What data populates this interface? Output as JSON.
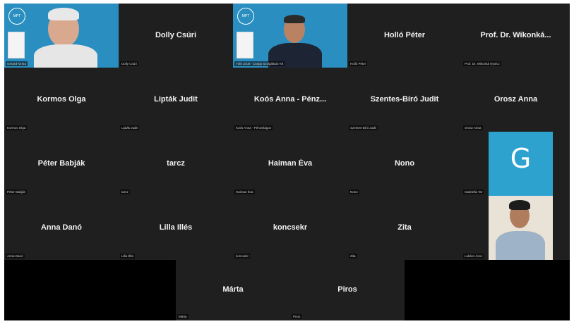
{
  "participants": {
    "p1": {
      "tag": "Gerard Kintra"
    },
    "p2": {
      "name": "Dolly Csúri",
      "tag": "Dolly Csúri"
    },
    "p3": {
      "tag": "Tóth Zsolt - Csepp Szolgáltató Kft"
    },
    "p4": {
      "name": "Holló Péter",
      "tag": "Holló Péter"
    },
    "p5": {
      "name": "Prof. Dr. Wikonká...",
      "tag": "Prof. Dr. Wikonká Nyolcz"
    },
    "p6": {
      "name": "Kormos Olga",
      "tag": "Kormos Olga"
    },
    "p7": {
      "name": "Lipták Judit",
      "tag": "Lipták Judit"
    },
    "p8": {
      "name": "Koós Anna - Pénz...",
      "tag": "Koós Anna - Pénzvilágon"
    },
    "p9": {
      "name": "Szentes-Bíró Judit",
      "tag": "Szentes-Bíró Judit"
    },
    "p10": {
      "name": "Orosz Anna",
      "tag": "Orosz Anna"
    },
    "p11": {
      "name": "Péter Babják",
      "tag": "Péter Babják"
    },
    "p12": {
      "name": "tarcz",
      "tag": "tarcz"
    },
    "p13": {
      "name": "Haiman Éva",
      "tag": "Haiman Éva"
    },
    "p14": {
      "name": "Nono",
      "tag": "Nono"
    },
    "p15": {
      "letter": "G",
      "tag": "Gabriella Tar"
    },
    "p16": {
      "name": "Anna Danó",
      "tag": "Anna Danó"
    },
    "p17": {
      "name": "Lilla Illés",
      "tag": "Lilla Illés"
    },
    "p18": {
      "name": "koncsekr",
      "tag": "koncsekr"
    },
    "p19": {
      "name": "Zita",
      "tag": "Zita"
    },
    "p20": {
      "tag": "Lukács Áron"
    },
    "p21": {
      "name": "Márta",
      "tag": "Márta"
    },
    "p22": {
      "name": "Piros",
      "tag": "Piros"
    }
  },
  "video_logo_text": "MPT",
  "colors": {
    "tile_bg": "#1f1f1f",
    "video_bg": "#2a8fc0",
    "avatar_bg": "#2ea2cf"
  }
}
